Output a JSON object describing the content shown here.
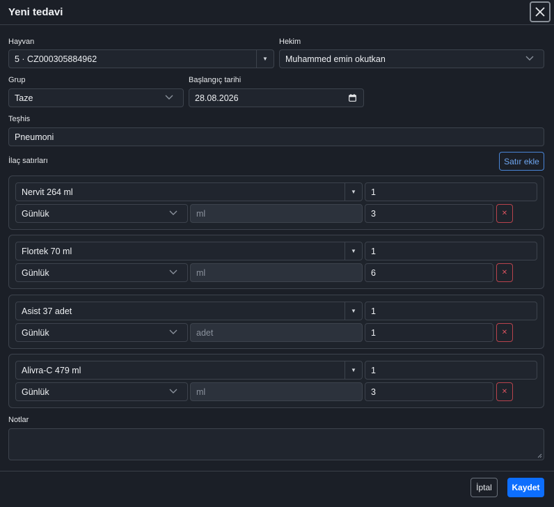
{
  "header": {
    "title": "Yeni tedavi"
  },
  "form": {
    "animal": {
      "label": "Hayvan",
      "value": "5 · CZ000305884962"
    },
    "vet": {
      "label": "Hekim",
      "value": "Muhammed emin okutkan"
    },
    "group": {
      "label": "Grup",
      "value": "Taze"
    },
    "start_date": {
      "label": "Başlangıç tarihi",
      "value": "28.08.2026"
    },
    "diagnosis": {
      "label": "Teşhis",
      "value": "Pneumoni"
    },
    "drug_lines_label": "İlaç satırları",
    "add_row_label": "Satır ekle",
    "notes_label": "Notlar",
    "notes_value": ""
  },
  "drug_rows": [
    {
      "drug": "Nervit 264 ml",
      "qty": "1",
      "freq": "Günlük",
      "unit": "ml",
      "days": "3"
    },
    {
      "drug": "Flortek 70 ml",
      "qty": "1",
      "freq": "Günlük",
      "unit": "ml",
      "days": "6"
    },
    {
      "drug": "Asist 37 adet",
      "qty": "1",
      "freq": "Günlük",
      "unit": "adet",
      "days": "1"
    },
    {
      "drug": "Alivra-C 479 ml",
      "qty": "1",
      "freq": "Günlük",
      "unit": "ml",
      "days": "3"
    }
  ],
  "footer": {
    "cancel_label": "İptal",
    "save_label": "Kaydet"
  },
  "colors": {
    "primary": "#0d6efd",
    "danger": "#d9535f",
    "outline_primary": "#4a86d8"
  },
  "icons": {
    "close": "close-icon",
    "caret": "caret-down-icon",
    "chevron": "chevron-down-icon",
    "calendar": "calendar-icon",
    "delete": "times-icon"
  }
}
